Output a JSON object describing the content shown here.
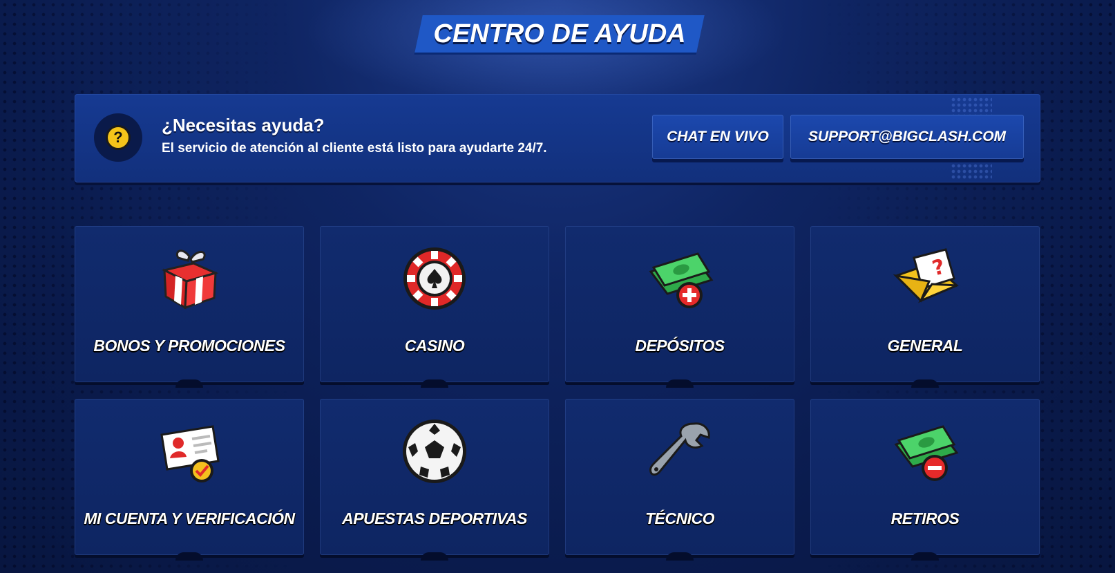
{
  "page": {
    "title": "CENTRO DE AYUDA"
  },
  "help": {
    "title": "¿Necesitas ayuda?",
    "subtitle": "El servicio de atención al cliente está listo para ayudarte 24/7.",
    "chat_label": "CHAT EN VIVO",
    "email_label": "SUPPORT@BIGCLASH.COM",
    "icon": "question-icon"
  },
  "categories": [
    {
      "label": "BONOS Y PROMOCIONES",
      "icon": "gift-icon"
    },
    {
      "label": "CASINO",
      "icon": "casino-chip-icon"
    },
    {
      "label": "DEPÓSITOS",
      "icon": "cash-plus-icon"
    },
    {
      "label": "GENERAL",
      "icon": "envelope-question-icon"
    },
    {
      "label": "MI CUENTA Y VERIFICACIÓN",
      "icon": "id-card-check-icon"
    },
    {
      "label": "APUESTAS DEPORTIVAS",
      "icon": "soccer-ball-icon"
    },
    {
      "label": "TÉCNICO",
      "icon": "wrench-icon"
    },
    {
      "label": "RETIROS",
      "icon": "cash-minus-icon"
    }
  ],
  "colors": {
    "background": "#0f2563",
    "accent": "#1f58c6",
    "card": "#112b6e"
  }
}
